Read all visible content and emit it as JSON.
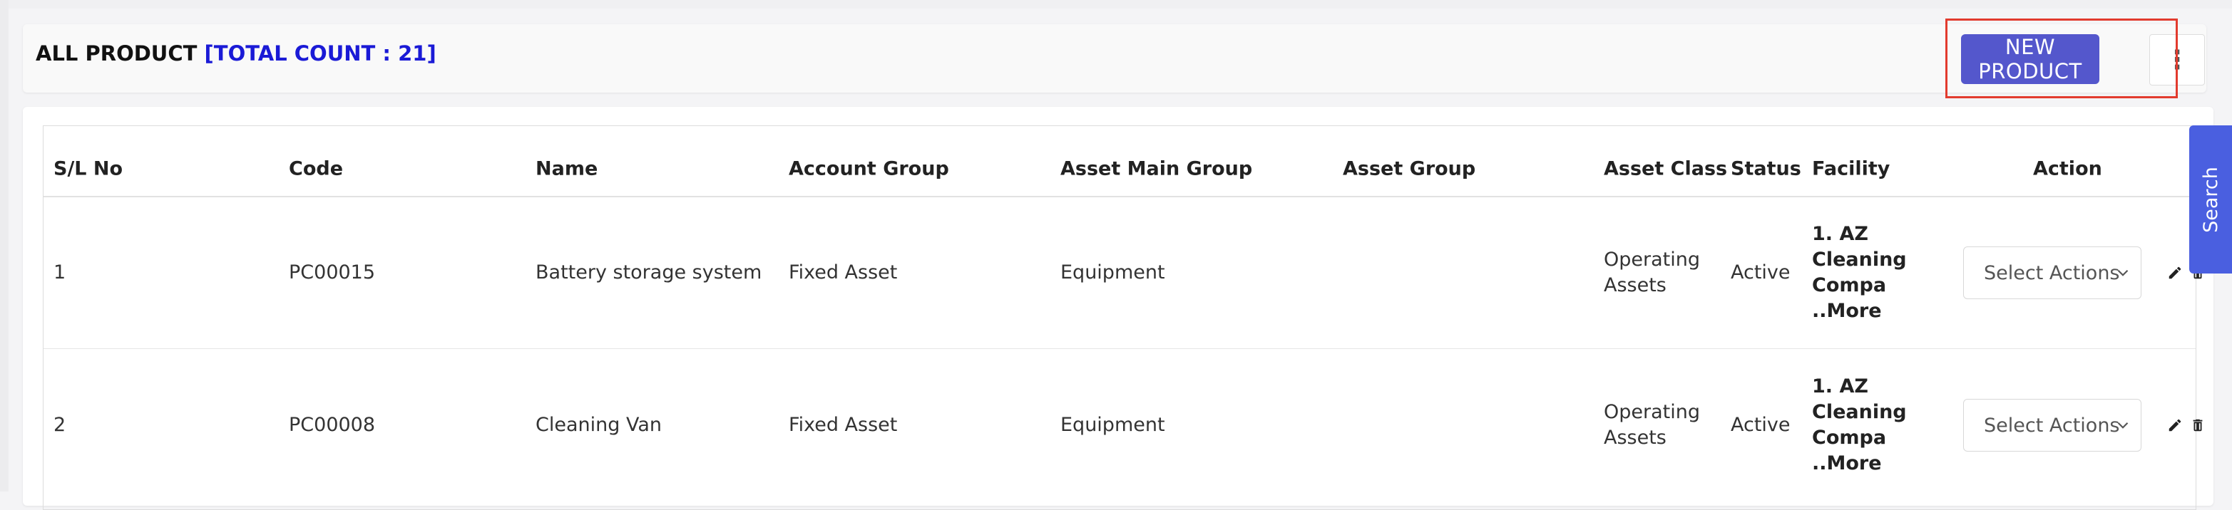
{
  "header": {
    "title": "ALL PRODUCT",
    "total_count": "[TOTAL COUNT : 21]",
    "new_product_label": "NEW PRODUCT",
    "more_label": "⋮"
  },
  "search_tab": {
    "label": "Search"
  },
  "table": {
    "columns": [
      "S/L No",
      "Code",
      "Name",
      "Account Group",
      "Asset Main Group",
      "Asset Group",
      "Asset Class",
      "Status",
      "Facility",
      "Action"
    ],
    "rows": [
      {
        "sl": "1",
        "code": "PC00015",
        "name": "Battery storage system",
        "account_group": "Fixed Asset",
        "asset_main_group": "Equipment",
        "asset_group": "",
        "asset_class_line1": "Operating",
        "asset_class_line2": "Assets",
        "status": "Active",
        "facility_line1": "1. AZ",
        "facility_line2": "Cleaning",
        "facility_line3": "Compa",
        "facility_more": "..More",
        "action_placeholder": "Select Actions"
      },
      {
        "sl": "2",
        "code": "PC00008",
        "name": "Cleaning Van",
        "account_group": "Fixed Asset",
        "asset_main_group": "Equipment",
        "asset_group": "",
        "asset_class_line1": "Operating",
        "asset_class_line2": "Assets",
        "status": "Active",
        "facility_line1": "1. AZ",
        "facility_line2": "Cleaning",
        "facility_line3": "Compa",
        "facility_more": "..More",
        "action_placeholder": "Select Actions"
      }
    ]
  },
  "colors": {
    "primary_button": "#5457cc",
    "highlight": "#e23b2e",
    "count_text": "#1a1ad6",
    "search_tab": "#4a5fe0"
  },
  "icons": [
    "more-vertical-icon",
    "chevron-down-icon",
    "pencil-icon",
    "trash-icon"
  ]
}
